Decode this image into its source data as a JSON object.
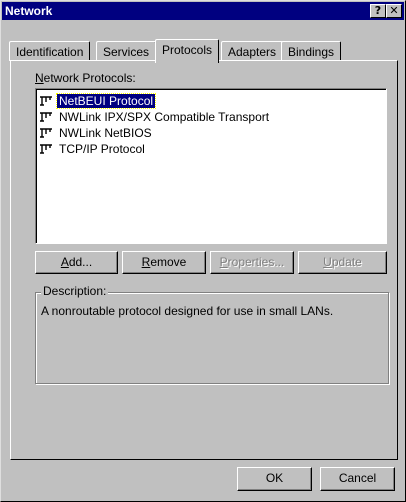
{
  "window": {
    "title": "Network",
    "help_glyph": "?",
    "close_glyph": "✕"
  },
  "tabs": [
    {
      "label": "Identification"
    },
    {
      "label": "Services"
    },
    {
      "label": "Protocols",
      "active": true
    },
    {
      "label": "Adapters"
    },
    {
      "label": "Bindings"
    }
  ],
  "protocols": {
    "label_first": "N",
    "label_rest": "etwork Protocols:",
    "items": [
      {
        "label": "NetBEUI Protocol",
        "selected": true,
        "icon": "protocol-icon"
      },
      {
        "label": "NWLink IPX/SPX Compatible Transport",
        "icon": "protocol-icon"
      },
      {
        "label": "NWLink NetBIOS",
        "icon": "protocol-icon"
      },
      {
        "label": "TCP/IP Protocol",
        "icon": "protocol-icon"
      }
    ]
  },
  "buttons": {
    "add_first": "A",
    "add_rest": "dd...",
    "remove_first": "R",
    "remove_rest": "emove",
    "properties_first": "P",
    "properties_rest": "roperties...",
    "update_first": "U",
    "update_rest": "pdate"
  },
  "description": {
    "caption": "Description:",
    "text": "A nonroutable protocol designed for use in small LANs."
  },
  "footer": {
    "ok_label": "OK",
    "cancel_label": "Cancel"
  },
  "colors": {
    "titlebar": "#000080",
    "face": "#c0c0c0",
    "selection": "#000080"
  }
}
